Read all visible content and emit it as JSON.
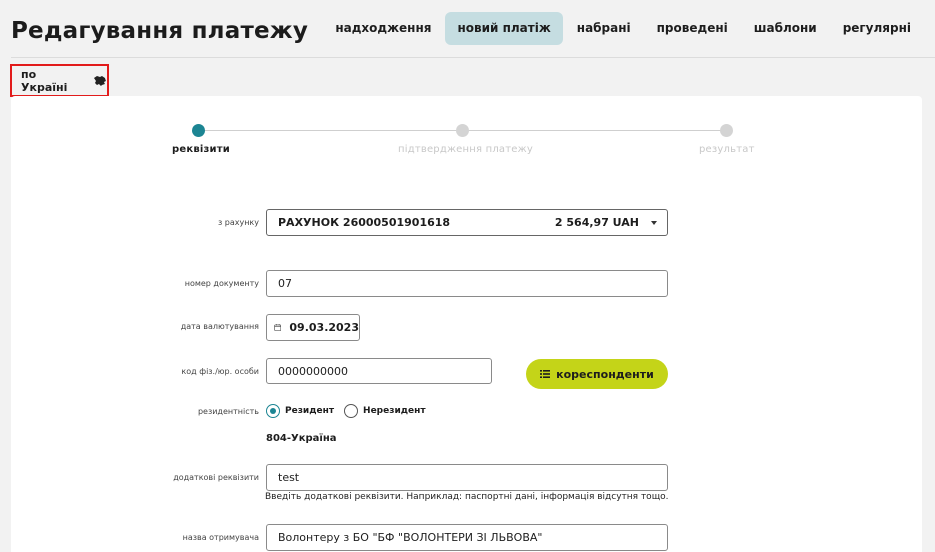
{
  "page": {
    "title": "Редагування платежу"
  },
  "tabs": [
    {
      "label": "надходження"
    },
    {
      "label": "новий платіж"
    },
    {
      "label": "набрані"
    },
    {
      "label": "проведені"
    },
    {
      "label": "шаблони"
    },
    {
      "label": "регулярні"
    }
  ],
  "subtab": {
    "label": "по Україні",
    "icon": "ukraine-map-icon"
  },
  "stepper": {
    "steps": [
      {
        "label": "реквізити",
        "state": "active"
      },
      {
        "label": "підтвердження платежу",
        "state": "inactive"
      },
      {
        "label": "результат",
        "state": "inactive"
      }
    ],
    "active_color": "#1c8593",
    "inactive_color": "#d4d4d4"
  },
  "form": {
    "account": {
      "label": "з рахунку",
      "value": "РАХУНОК 26000501901618",
      "balance": "2 564,97 UAH"
    },
    "doc_number": {
      "label": "номер документу",
      "value": "07"
    },
    "value_date": {
      "label": "дата валютування",
      "value": "09.03.2023"
    },
    "tax_code": {
      "label": "код фіз./юр. особи",
      "value": "0000000000"
    },
    "correspondents_button": "кореспонденти",
    "residency": {
      "label": "резидентність",
      "options": [
        "Резидент",
        "Нерезидент"
      ],
      "selected": "Резидент"
    },
    "country": "804-Україна",
    "extra_details": {
      "label": "додаткові реквізити",
      "value": "test",
      "hint": "Введіть додаткові реквізити. Наприклад: паспортні дані, інформація відсутня тощо."
    },
    "recipient_name": {
      "label": "назва отримувача",
      "value": "Волонтеру з БО \"БФ \"ВОЛОНТЕРИ ЗІ ЛЬВОВА\""
    }
  },
  "colors": {
    "accent": "#1c8593",
    "button": "#c4d418",
    "active_tab_bg": "#c5dde1",
    "highlight_border": "#e21b1b"
  }
}
